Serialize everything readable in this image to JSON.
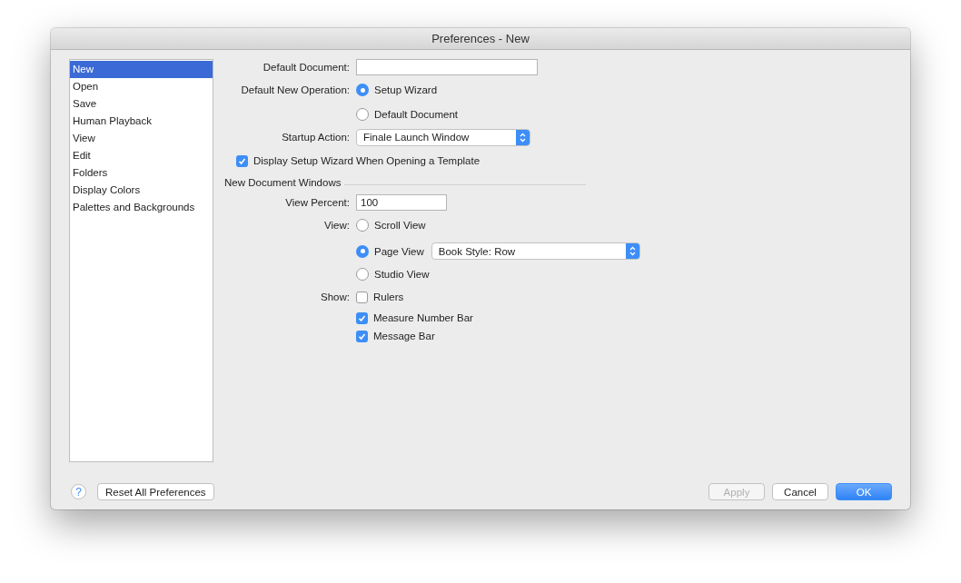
{
  "window": {
    "title": "Preferences - New"
  },
  "sidebar": {
    "items": [
      {
        "label": "New",
        "selected": true
      },
      {
        "label": "Open",
        "selected": false
      },
      {
        "label": "Save",
        "selected": false
      },
      {
        "label": "Human Playback",
        "selected": false
      },
      {
        "label": "View",
        "selected": false
      },
      {
        "label": "Edit",
        "selected": false
      },
      {
        "label": "Folders",
        "selected": false
      },
      {
        "label": "Display Colors",
        "selected": false
      },
      {
        "label": "Palettes and Backgrounds",
        "selected": false
      }
    ]
  },
  "default_document": {
    "label": "Default Document:"
  },
  "default_new_operation": {
    "label": "Default New Operation:",
    "options": [
      {
        "label": "Setup Wizard",
        "selected": true
      },
      {
        "label": "Default Document",
        "selected": false
      }
    ]
  },
  "startup_action": {
    "label": "Startup Action:",
    "value": "Finale Launch Window"
  },
  "display_setup_wizard": {
    "label": "Display Setup Wizard When Opening a Template",
    "checked": true
  },
  "new_document_windows": {
    "title": "New Document Windows",
    "view_percent": {
      "label": "View Percent:",
      "value": "100"
    },
    "view": {
      "label": "View:",
      "options": [
        {
          "label": "Scroll View",
          "selected": false
        },
        {
          "label": "Page View",
          "selected": true,
          "dropdown": "Book Style: Row"
        },
        {
          "label": "Studio View",
          "selected": false
        }
      ]
    },
    "show": {
      "label": "Show:",
      "options": [
        {
          "label": "Rulers",
          "checked": false
        },
        {
          "label": "Measure Number Bar",
          "checked": true
        },
        {
          "label": "Message Bar",
          "checked": true
        }
      ]
    }
  },
  "footer": {
    "help": "?",
    "reset": "Reset All Preferences",
    "buttons": [
      {
        "label": "Apply",
        "disabled": true,
        "default": false
      },
      {
        "label": "Cancel",
        "disabled": false,
        "default": false
      },
      {
        "label": "OK",
        "disabled": false,
        "default": true
      }
    ]
  }
}
